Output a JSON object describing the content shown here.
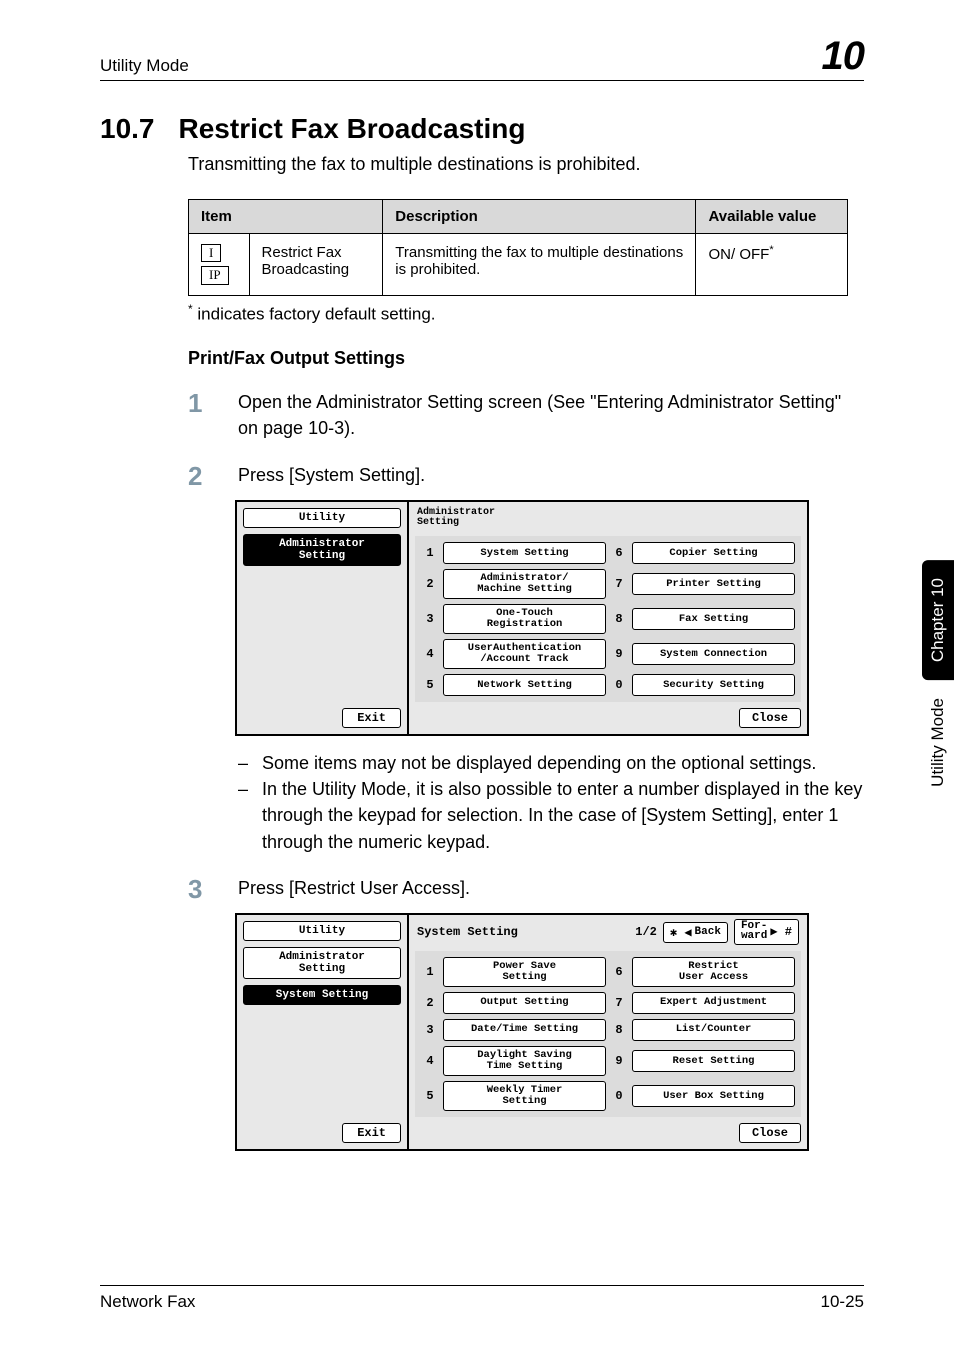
{
  "header": {
    "running": "Utility Mode",
    "chapter_number": "10"
  },
  "section": {
    "number": "10.7",
    "title": "Restrict Fax Broadcasting",
    "intro": "Transmitting the fax to multiple destinations is prohibited."
  },
  "table": {
    "cols": {
      "item": "Item",
      "desc": "Description",
      "val": "Available value"
    },
    "row": {
      "badge1": "I",
      "badge2": "IP",
      "name": "Restrict Fax Broadcasting",
      "desc": "Transmitting the fax to multiple destinations is prohibited.",
      "val": "ON/ OFF",
      "val_mark": "*"
    }
  },
  "footnote": {
    "mark": "*",
    "text": " indicates factory default setting."
  },
  "subhead": "Print/Fax Output Settings",
  "step1": {
    "n": "1",
    "text": "Open the Administrator Setting screen (See \"Entering Administrator Setting\" on page 10-3)."
  },
  "step2": {
    "n": "2",
    "text": "Press [System Setting]."
  },
  "screen1": {
    "left_items": [
      "Utility",
      "Administrator\nSetting"
    ],
    "title": "Administrator\nSetting",
    "leftcol": [
      {
        "n": "1",
        "label": "System Setting"
      },
      {
        "n": "2",
        "label": "Administrator/\nMachine Setting"
      },
      {
        "n": "3",
        "label": "One-Touch\nRegistration"
      },
      {
        "n": "4",
        "label": "UserAuthentication\n/Account Track"
      },
      {
        "n": "5",
        "label": "Network Setting"
      }
    ],
    "rightcol": [
      {
        "n": "6",
        "label": "Copier Setting"
      },
      {
        "n": "7",
        "label": "Printer Setting"
      },
      {
        "n": "8",
        "label": "Fax Setting"
      },
      {
        "n": "9",
        "label": "System Connection"
      },
      {
        "n": "0",
        "label": "Security Setting"
      }
    ],
    "exit": "Exit",
    "close": "Close"
  },
  "notes": [
    "Some items may not be displayed depending on the optional settings.",
    "In the Utility Mode, it is also possible to enter a number displayed in the key through the keypad for selection. In the case of [System Setting], enter 1 through the numeric keypad."
  ],
  "step3": {
    "n": "3",
    "text": "Press [Restrict User Access]."
  },
  "screen2": {
    "left_items": [
      "Utility",
      "Administrator\nSetting",
      "System Setting"
    ],
    "title": "System Setting",
    "page": "1/2",
    "back": "Back",
    "fwd": "For-\nward",
    "leftcol": [
      {
        "n": "1",
        "label": "Power Save\nSetting"
      },
      {
        "n": "2",
        "label": "Output Setting"
      },
      {
        "n": "3",
        "label": "Date/Time Setting"
      },
      {
        "n": "4",
        "label": "Daylight Saving\nTime Setting"
      },
      {
        "n": "5",
        "label": "Weekly Timer\nSetting"
      }
    ],
    "rightcol": [
      {
        "n": "6",
        "label": "Restrict\nUser Access"
      },
      {
        "n": "7",
        "label": "Expert Adjustment"
      },
      {
        "n": "8",
        "label": "List/Counter"
      },
      {
        "n": "9",
        "label": "Reset Setting"
      },
      {
        "n": "0",
        "label": "User Box Setting"
      }
    ],
    "exit": "Exit",
    "close": "Close"
  },
  "sidebar": {
    "black": "Chapter 10",
    "white": "Utility Mode"
  },
  "footer": {
    "left": "Network Fax",
    "right": "10-25"
  },
  "chart_data": null
}
